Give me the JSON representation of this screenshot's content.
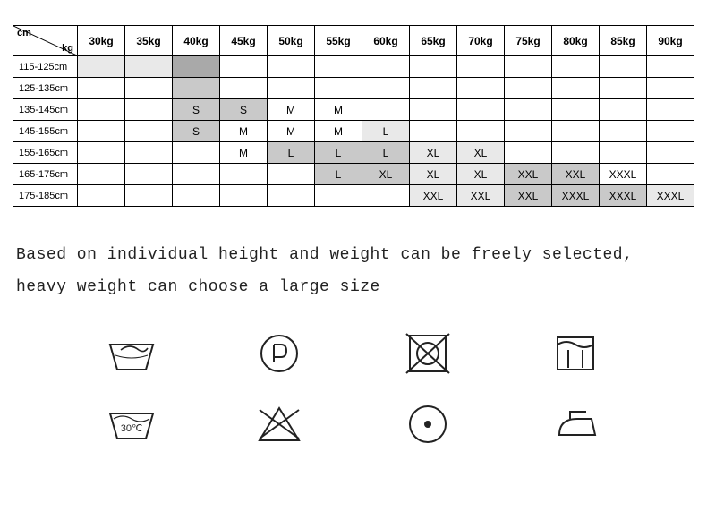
{
  "corner": {
    "cm": "cm",
    "kg": "kg"
  },
  "weights": [
    "30kg",
    "35kg",
    "40kg",
    "45kg",
    "50kg",
    "55kg",
    "60kg",
    "65kg",
    "70kg",
    "75kg",
    "80kg",
    "85kg",
    "90kg"
  ],
  "heights": [
    "115-125cm",
    "125-135cm",
    "135-145cm",
    "145-155cm",
    "155-165cm",
    "165-175cm",
    "175-185cm"
  ],
  "chart_data": {
    "type": "table",
    "title": "Size by height and weight",
    "xlabel": "kg",
    "ylabel": "cm",
    "categories": [
      "30kg",
      "35kg",
      "40kg",
      "45kg",
      "50kg",
      "55kg",
      "60kg",
      "65kg",
      "70kg",
      "75kg",
      "80kg",
      "85kg",
      "90kg"
    ],
    "rows": [
      "115-125cm",
      "125-135cm",
      "135-145cm",
      "145-155cm",
      "155-165cm",
      "165-175cm",
      "175-185cm"
    ],
    "cells": [
      [
        {
          "v": "",
          "s": "lt"
        },
        {
          "v": "",
          "s": "lt"
        },
        {
          "v": "",
          "s": "dk"
        },
        {
          "v": ""
        },
        {
          "v": ""
        },
        {
          "v": ""
        },
        {
          "v": ""
        },
        {
          "v": ""
        },
        {
          "v": ""
        },
        {
          "v": ""
        },
        {
          "v": ""
        },
        {
          "v": ""
        },
        {
          "v": ""
        }
      ],
      [
        {
          "v": ""
        },
        {
          "v": ""
        },
        {
          "v": "",
          "s": "md"
        },
        {
          "v": ""
        },
        {
          "v": ""
        },
        {
          "v": ""
        },
        {
          "v": ""
        },
        {
          "v": ""
        },
        {
          "v": ""
        },
        {
          "v": ""
        },
        {
          "v": ""
        },
        {
          "v": ""
        },
        {
          "v": ""
        }
      ],
      [
        {
          "v": ""
        },
        {
          "v": ""
        },
        {
          "v": "S",
          "s": "md"
        },
        {
          "v": "S",
          "s": "md"
        },
        {
          "v": "M"
        },
        {
          "v": "M"
        },
        {
          "v": ""
        },
        {
          "v": ""
        },
        {
          "v": ""
        },
        {
          "v": ""
        },
        {
          "v": ""
        },
        {
          "v": ""
        },
        {
          "v": ""
        }
      ],
      [
        {
          "v": ""
        },
        {
          "v": ""
        },
        {
          "v": "S",
          "s": "md"
        },
        {
          "v": "M"
        },
        {
          "v": "M"
        },
        {
          "v": "M"
        },
        {
          "v": "L",
          "s": "lt"
        },
        {
          "v": ""
        },
        {
          "v": ""
        },
        {
          "v": ""
        },
        {
          "v": ""
        },
        {
          "v": ""
        },
        {
          "v": ""
        }
      ],
      [
        {
          "v": ""
        },
        {
          "v": ""
        },
        {
          "v": ""
        },
        {
          "v": "M"
        },
        {
          "v": "L",
          "s": "md"
        },
        {
          "v": "L",
          "s": "md"
        },
        {
          "v": "L",
          "s": "md"
        },
        {
          "v": "XL",
          "s": "lt"
        },
        {
          "v": "XL",
          "s": "lt"
        },
        {
          "v": ""
        },
        {
          "v": ""
        },
        {
          "v": ""
        },
        {
          "v": ""
        }
      ],
      [
        {
          "v": ""
        },
        {
          "v": ""
        },
        {
          "v": ""
        },
        {
          "v": ""
        },
        {
          "v": ""
        },
        {
          "v": "L",
          "s": "md"
        },
        {
          "v": "XL",
          "s": "md"
        },
        {
          "v": "XL",
          "s": "lt"
        },
        {
          "v": "XL",
          "s": "lt"
        },
        {
          "v": "XXL",
          "s": "md"
        },
        {
          "v": "XXL",
          "s": "md"
        },
        {
          "v": "XXXL"
        },
        {
          "v": ""
        }
      ],
      [
        {
          "v": ""
        },
        {
          "v": ""
        },
        {
          "v": ""
        },
        {
          "v": ""
        },
        {
          "v": ""
        },
        {
          "v": ""
        },
        {
          "v": ""
        },
        {
          "v": "XXL",
          "s": "lt"
        },
        {
          "v": "XXL",
          "s": "lt"
        },
        {
          "v": "XXL",
          "s": "md"
        },
        {
          "v": "XXXL",
          "s": "md"
        },
        {
          "v": "XXXL",
          "s": "md"
        },
        {
          "v": "XXXL",
          "s": "lt"
        }
      ]
    ]
  },
  "note_line1": "Based on individual height and weight can be freely selected,",
  "note_line2": " heavy weight can choose a large size",
  "wash30_label": "30℃",
  "care_icons_row1": [
    "hand-wash-icon",
    "dryclean-p-icon",
    "do-not-tumble-dry-icon",
    "dry-flat-icon"
  ],
  "care_icons_row2": [
    "wash-30-icon",
    "do-not-bleach-icon",
    "tumble-dry-low-icon",
    "iron-icon"
  ]
}
